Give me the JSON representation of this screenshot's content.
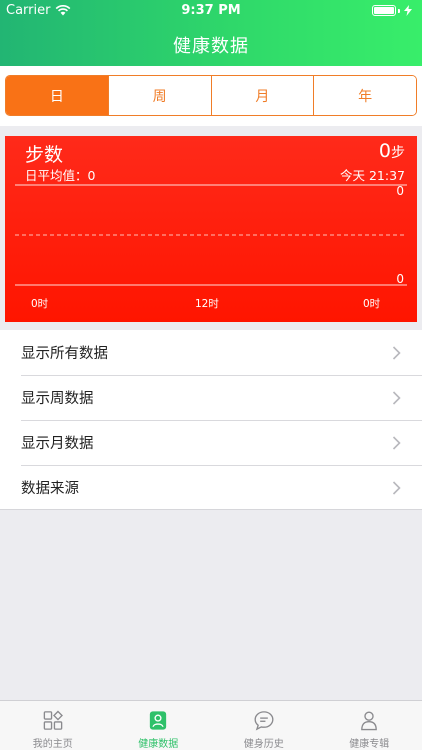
{
  "status": {
    "carrier": "Carrier",
    "time": "9:37 PM"
  },
  "nav": {
    "title": "健康数据"
  },
  "segments": [
    {
      "label": "日",
      "active": true
    },
    {
      "label": "周",
      "active": false
    },
    {
      "label": "月",
      "active": false
    },
    {
      "label": "年",
      "active": false
    }
  ],
  "summary": {
    "title": "步数",
    "average": "日平均值：0",
    "total_value": "0",
    "total_unit": "步",
    "date": "今天 21:37"
  },
  "chart_data": {
    "type": "line",
    "x_ticks": [
      "0时",
      "12时",
      "0时"
    ],
    "y_ticks": [
      "0",
      "0"
    ],
    "values": [],
    "grid": true
  },
  "list": [
    {
      "label": "显示所有数据"
    },
    {
      "label": "显示周数据"
    },
    {
      "label": "显示月数据"
    },
    {
      "label": "数据来源"
    }
  ],
  "tabs": [
    {
      "label": "我的主页",
      "icon": "grid-shapes-icon",
      "active": false
    },
    {
      "label": "健康数据",
      "icon": "person-card-icon",
      "active": true
    },
    {
      "label": "健身历史",
      "icon": "chat-bubble-icon",
      "active": false
    },
    {
      "label": "健康专辑",
      "icon": "person-outline-icon",
      "active": false
    }
  ],
  "colors": {
    "nav_green": "#2fd86a",
    "accent_orange": "#f97216",
    "chart_red": "#ff1a00",
    "tab_active": "#2fc16a"
  }
}
